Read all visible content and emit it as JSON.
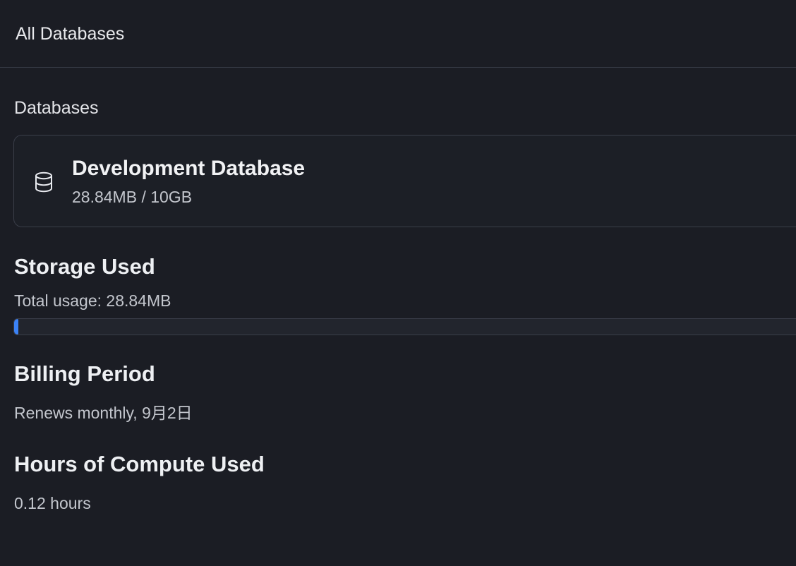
{
  "header": {
    "title": "All Databases"
  },
  "databases": {
    "section_label": "Databases",
    "items": [
      {
        "icon": "database-icon",
        "name": "Development Database",
        "usage": "28.84MB / 10GB"
      }
    ]
  },
  "storage": {
    "title": "Storage Used",
    "total_label": "Total usage: 28.84MB",
    "used_fraction": 0.00288
  },
  "billing": {
    "title": "Billing Period",
    "text": "Renews monthly, 9月2日"
  },
  "compute": {
    "title": "Hours of Compute Used",
    "value": "0.12 hours"
  },
  "colors": {
    "background": "#1b1d24",
    "accent": "#3b82f6",
    "border": "#3a3e49"
  }
}
